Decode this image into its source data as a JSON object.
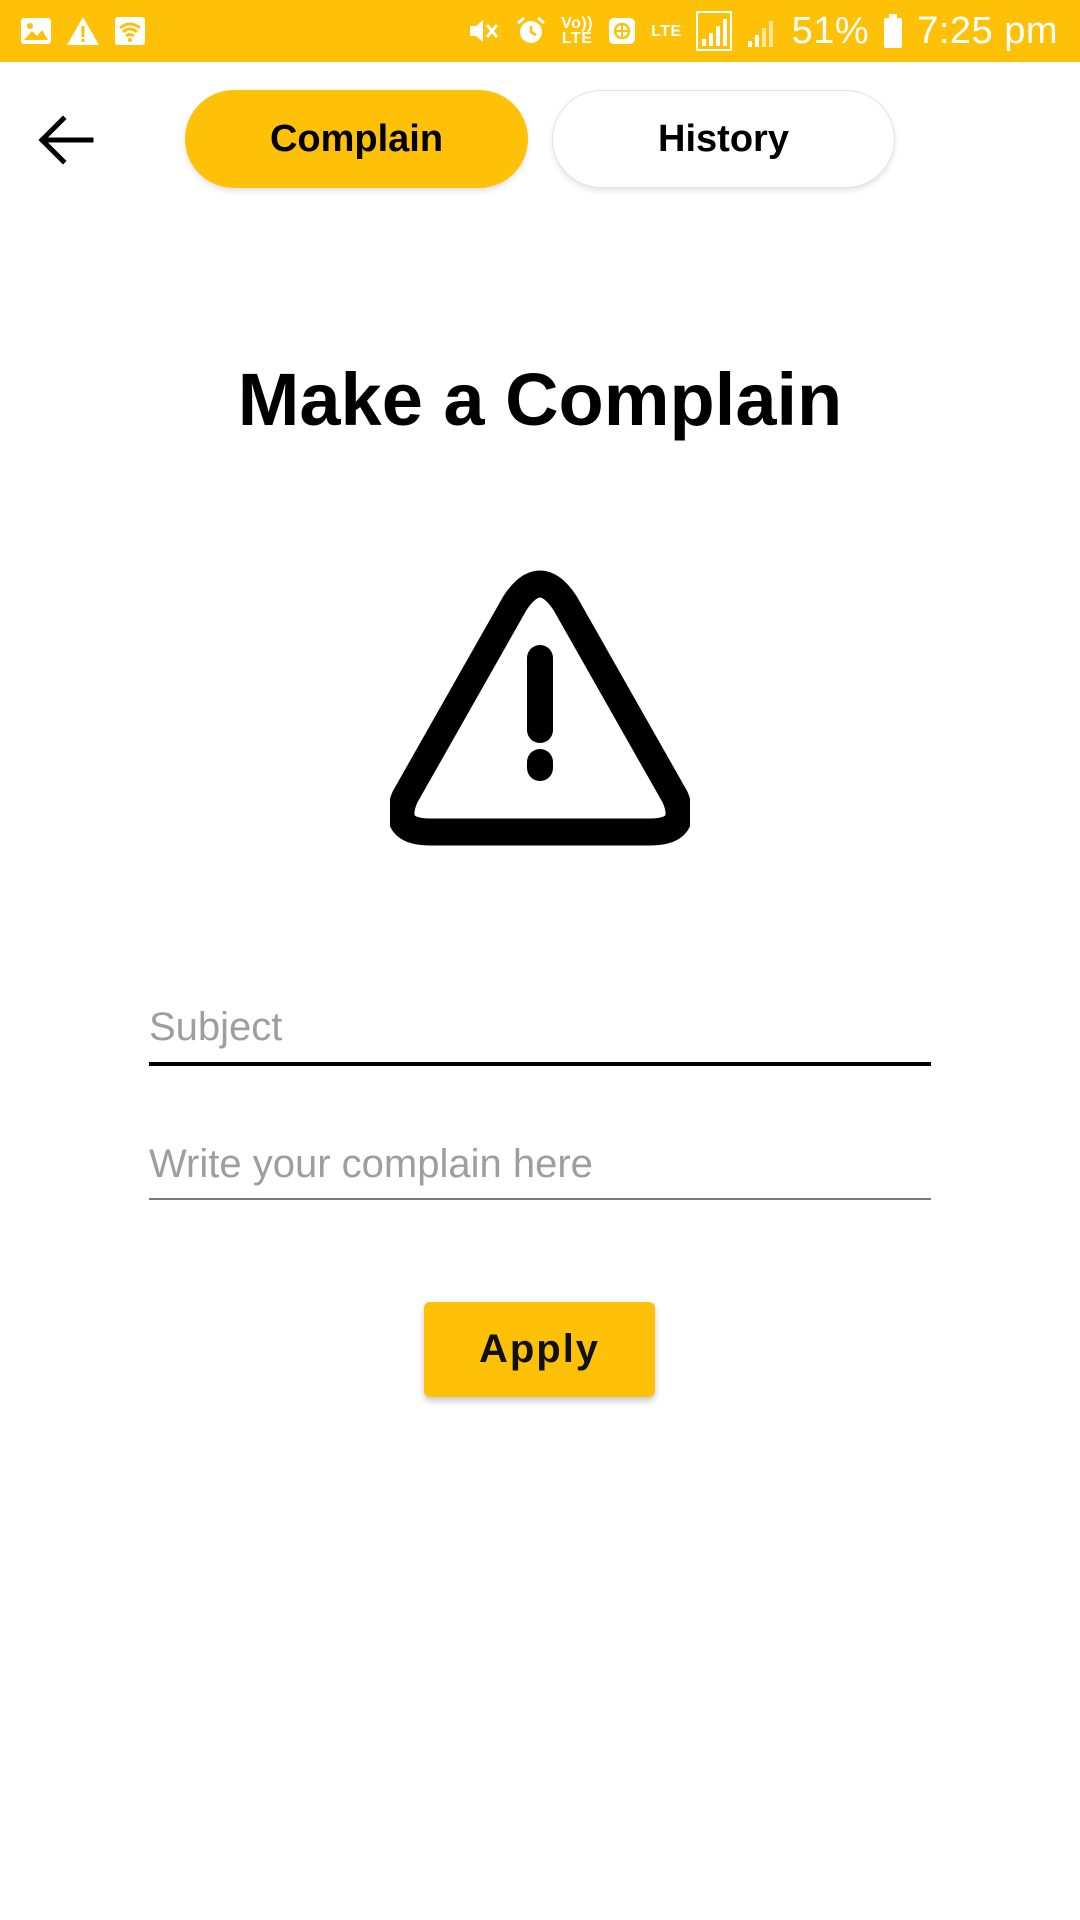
{
  "status_bar": {
    "battery_percent": "51%",
    "time": "7:25 pm",
    "volte_label": "Vo)) LTE",
    "lte_label": "LTE",
    "background": "#FFC107"
  },
  "header": {
    "back_icon": "arrow-left-icon",
    "tabs": [
      {
        "label": "Complain",
        "active": true
      },
      {
        "label": "History",
        "active": false
      }
    ]
  },
  "main": {
    "title": "Make a Complain",
    "icon": "warning-triangle-icon",
    "subject": {
      "placeholder": "Subject",
      "value": ""
    },
    "complain": {
      "placeholder": "Write your complain here",
      "value": ""
    },
    "apply_label": "Apply"
  },
  "colors": {
    "accent": "#FFC107",
    "text": "#000000",
    "placeholder": "#9E9E9E"
  }
}
